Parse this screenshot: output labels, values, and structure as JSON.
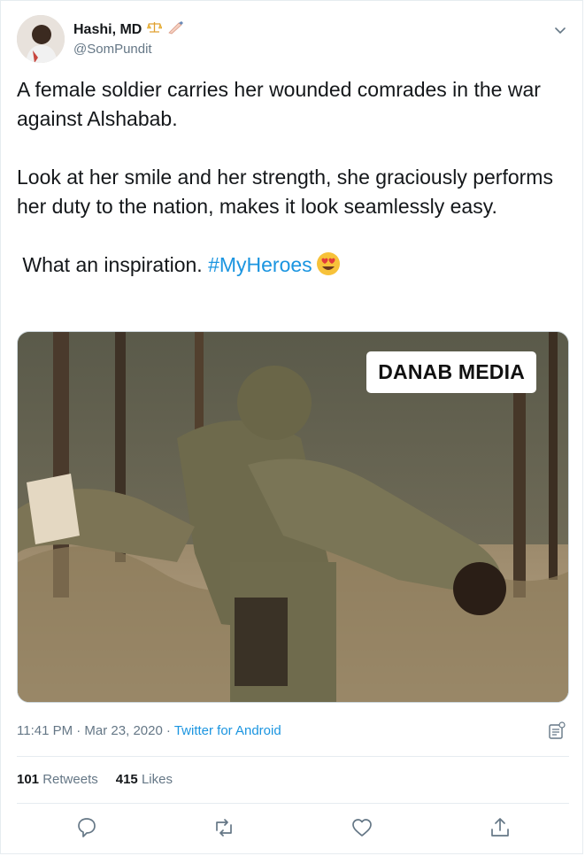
{
  "user": {
    "display_name": "Hashi, MD",
    "handle": "@SomPundit",
    "name_emojis": [
      "scales-icon",
      "writing-hand-icon"
    ]
  },
  "tweet": {
    "line1": "A female soldier carries her wounded comrades in the war against Alshabab.",
    "line2": "Look at her smile and her strength, she graciously performs her duty to the nation, makes it look seamlessly easy.",
    "line3_text": "What an inspiration. ",
    "hashtag": "#MyHeroes",
    "emoji": "heart-eyes-emoji"
  },
  "media": {
    "watermark": "DANAB MEDIA"
  },
  "meta": {
    "time": "11:41 PM · Mar 23, 2020",
    "separator": "·",
    "source": "Twitter for Android"
  },
  "stats": {
    "retweets_count": "101",
    "retweets_label": "Retweets",
    "likes_count": "415",
    "likes_label": "Likes"
  },
  "colors": {
    "link": "#1b95e0",
    "secondary_text": "#657786",
    "divider": "#e6ecf0"
  }
}
